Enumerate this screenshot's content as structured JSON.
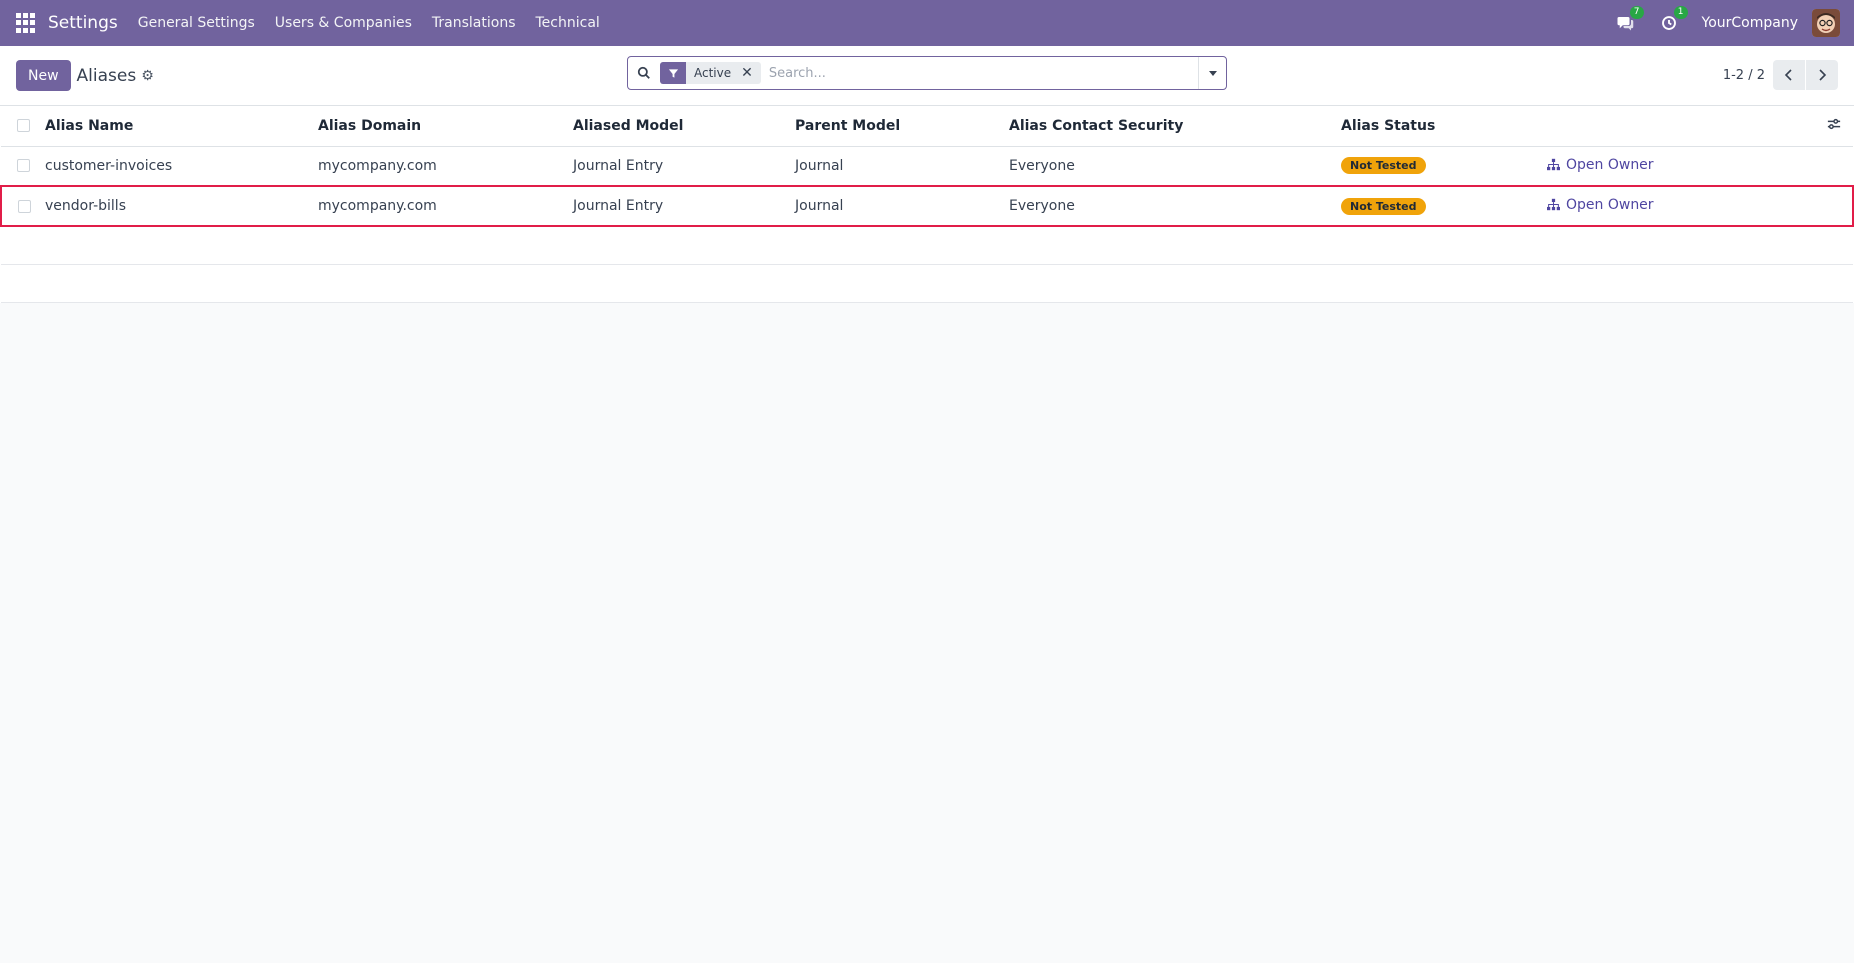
{
  "navbar": {
    "brand": "Settings",
    "menu": [
      "General Settings",
      "Users & Companies",
      "Translations",
      "Technical"
    ],
    "messages_count": "7",
    "activities_count": "1",
    "company": "YourCompany"
  },
  "control_panel": {
    "new_label": "New",
    "breadcrumb": "Aliases",
    "search": {
      "facet": "Active",
      "placeholder": "Search..."
    },
    "pager": "1-2 / 2"
  },
  "table": {
    "headers": [
      "Alias Name",
      "Alias Domain",
      "Aliased Model",
      "Parent Model",
      "Alias Contact Security",
      "Alias Status"
    ],
    "rows": [
      {
        "alias_name": "customer-invoices",
        "alias_domain": "mycompany.com",
        "aliased_model": "Journal Entry",
        "parent_model": "Journal",
        "contact_security": "Everyone",
        "status": "Not Tested",
        "action": "Open Owner"
      },
      {
        "alias_name": "vendor-bills",
        "alias_domain": "mycompany.com",
        "aliased_model": "Journal Entry",
        "parent_model": "Journal",
        "contact_security": "Everyone",
        "status": "Not Tested",
        "action": "Open Owner"
      }
    ]
  },
  "colors": {
    "brand": "#71639e",
    "status_badge": "#f0a30a",
    "highlight": "#e11d48"
  }
}
